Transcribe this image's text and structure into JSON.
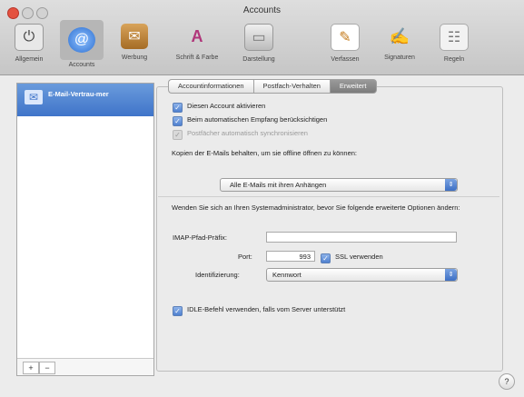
{
  "window": {
    "title": "Accounts"
  },
  "toolbar": {
    "items": [
      {
        "label": "Allgemein",
        "icon": "switch-icon"
      },
      {
        "label": "Accounts",
        "icon": "at-sign-icon"
      },
      {
        "label": "Werbung",
        "icon": "junk-mail-icon"
      },
      {
        "label": "Schrift & Farbe",
        "icon": "fonts-colors-icon"
      },
      {
        "label": "Darstellung",
        "icon": "viewing-icon"
      },
      {
        "label": "Verfassen",
        "icon": "composing-icon"
      },
      {
        "label": "Signaturen",
        "icon": "signature-icon"
      },
      {
        "label": "Regeln",
        "icon": "rules-icon"
      }
    ]
  },
  "sidebar": {
    "account_label": "E-Mail-Vertrau-mer",
    "add_label": "+",
    "remove_label": "−"
  },
  "tabs": [
    {
      "label": "Accountinformationen"
    },
    {
      "label": "Postfach-Verhalten"
    },
    {
      "label": "Erweitert"
    }
  ],
  "advanced": {
    "enable_account": "Diesen Account aktivieren",
    "include_auto": "Beim automatischen Empfang berücksichtigen",
    "sync_auto": "Postfächer automatisch synchronisieren",
    "keep_copies_label": "Kopien der E-Mails behalten, um sie offline öffnen zu können:",
    "keep_copies_value": "Alle E-Mails mit ihren Anhängen",
    "admin_note": "Wenden Sie sich an Ihren Systemadministrator, bevor Sie folgende erweiterte Optionen ändern:",
    "imap_prefix_label": "IMAP-Pfad-Präfix:",
    "imap_prefix_value": "",
    "port_label": "Port:",
    "port_value": "993",
    "ssl_label": "SSL verwenden",
    "auth_label": "Identifizierung:",
    "auth_value": "Kennwort",
    "idle_label": "IDLE-Befehl verwenden, falls vom Server unterstützt"
  },
  "help": {
    "label": "?"
  }
}
